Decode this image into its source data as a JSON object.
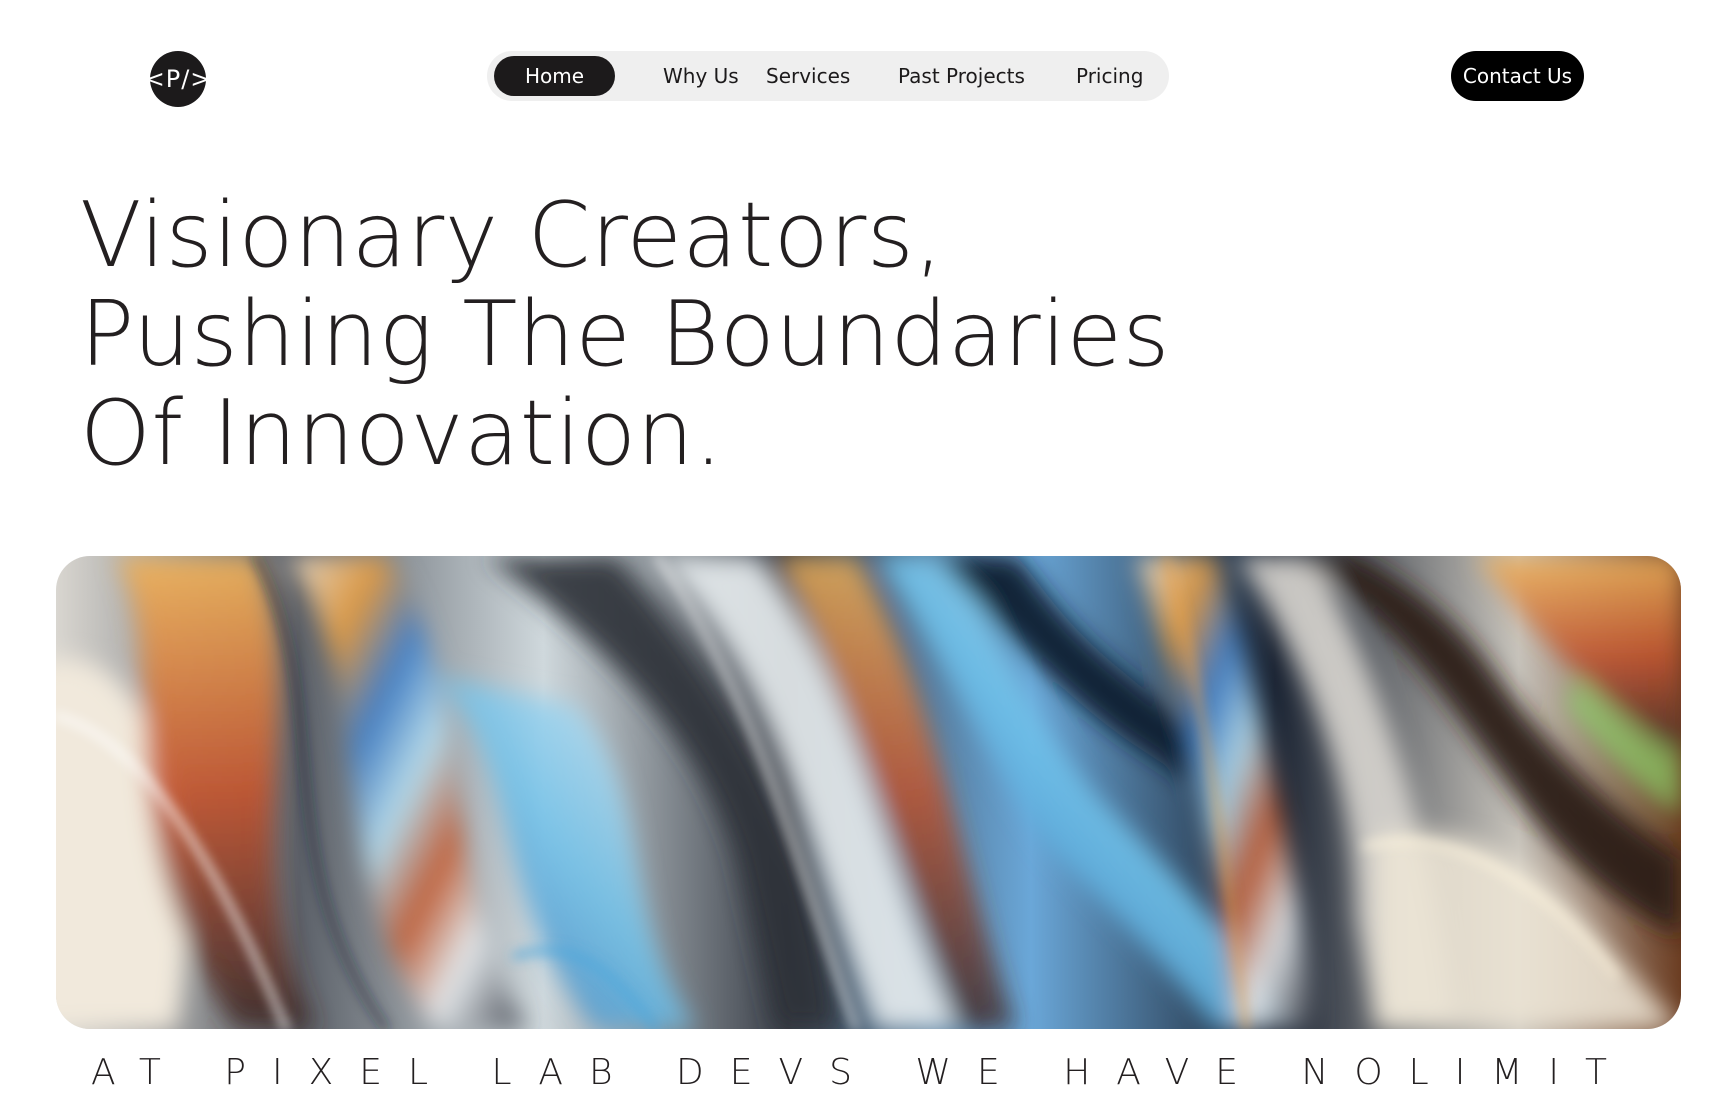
{
  "brand": {
    "logo_text": "<P/>"
  },
  "nav": {
    "items": [
      {
        "label": "Home",
        "active": true
      },
      {
        "label": "Why Us",
        "active": false
      },
      {
        "label": "Services",
        "active": false
      },
      {
        "label": "Past Projects",
        "active": false
      },
      {
        "label": "Pricing",
        "active": false
      }
    ]
  },
  "header": {
    "contact_label": "Contact Us"
  },
  "hero": {
    "headline_lines": [
      "Visionary Creators,",
      "Pushing The Boundaries",
      "Of Innovation."
    ],
    "image_icon": "iridescent-liquid-chrome-image"
  },
  "tagline": "AT PIXEL LAB DEVS WE HAVE NOLIMIT",
  "colors": {
    "text": "#231f20",
    "nav_background": "#efefef",
    "dark": "#1c1a1b",
    "background": "#ffffff"
  }
}
